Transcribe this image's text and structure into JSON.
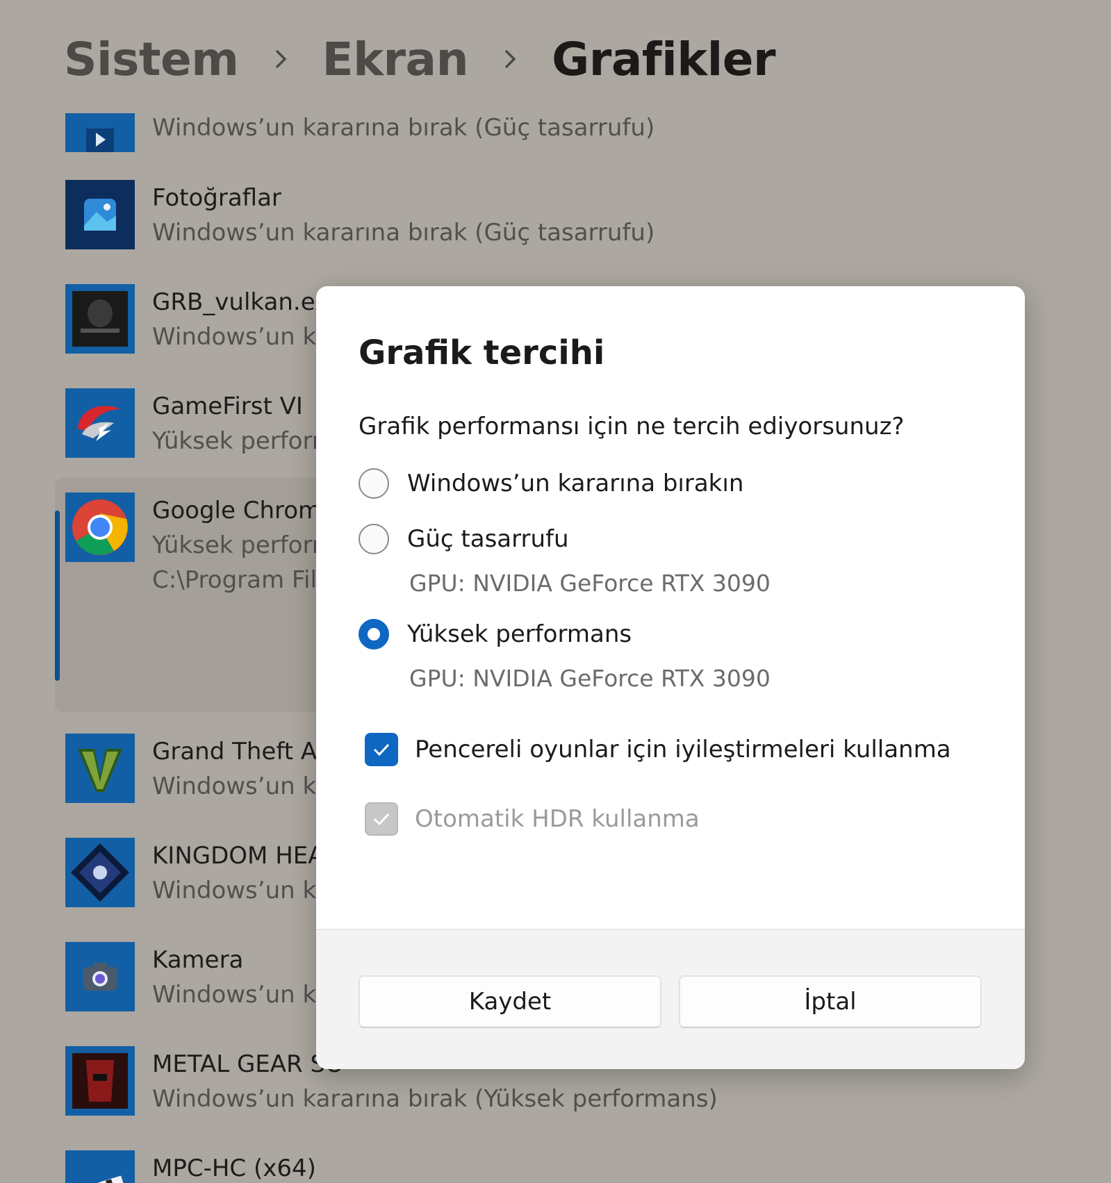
{
  "breadcrumb": {
    "items": [
      "Sistem",
      "Ekran",
      "Grafikler"
    ]
  },
  "apps": [
    {
      "name": "",
      "pref": "Windows’un kararına bırak (Güç tasarrufu)",
      "icon": "media-player-icon"
    },
    {
      "name": "Fotoğraflar",
      "pref": "Windows’un kararına bırak (Güç tasarrufu)",
      "icon": "photos-icon"
    },
    {
      "name": "GRB_vulkan.exe",
      "pref": "Windows’un ka",
      "icon": "ghost-recon-icon"
    },
    {
      "name": "GameFirst VI",
      "pref": "Yüksek perform",
      "icon": "gamefirst-icon"
    },
    {
      "name": "Google Chrome",
      "pref": "Yüksek perform",
      "path": "C:\\Program File",
      "icon": "chrome-icon"
    },
    {
      "name": "Grand Theft Au",
      "pref": "Windows’un ka",
      "icon": "gta-v-icon"
    },
    {
      "name": "KINGDOM HEA",
      "pref": "Windows’un ka",
      "icon": "kingdom-hearts-icon"
    },
    {
      "name": "Kamera",
      "pref": "Windows’un ka",
      "icon": "camera-icon"
    },
    {
      "name": "METAL GEAR SO",
      "pref": "Windows’un kararına bırak (Yüksek performans)",
      "icon": "metal-gear-icon"
    },
    {
      "name": "MPC-HC (x64)",
      "pref": "",
      "icon": "clapperboard-icon"
    }
  ],
  "dialog": {
    "title": "Grafik tercihi",
    "question": "Grafik performansı için ne tercih ediyorsunuz?",
    "options": [
      {
        "label": "Windows’un kararına bırakın",
        "gpu": "",
        "selected": false
      },
      {
        "label": "Güç tasarrufu",
        "gpu": "GPU: NVIDIA GeForce RTX 3090",
        "selected": false
      },
      {
        "label": "Yüksek performans",
        "gpu": "GPU: NVIDIA GeForce RTX 3090",
        "selected": true
      }
    ],
    "checkboxes": [
      {
        "label": "Pencereli oyunlar için iyileştirmeleri kullanma",
        "checked": true,
        "disabled": false
      },
      {
        "label": "Otomatik HDR kullanma",
        "checked": true,
        "disabled": true
      }
    ],
    "buttons": {
      "save": "Kaydet",
      "cancel": "İptal"
    }
  },
  "colors": {
    "accent": "#0f67c2",
    "backdrop": "#aca7a0",
    "app_tile": "#135fa5"
  }
}
